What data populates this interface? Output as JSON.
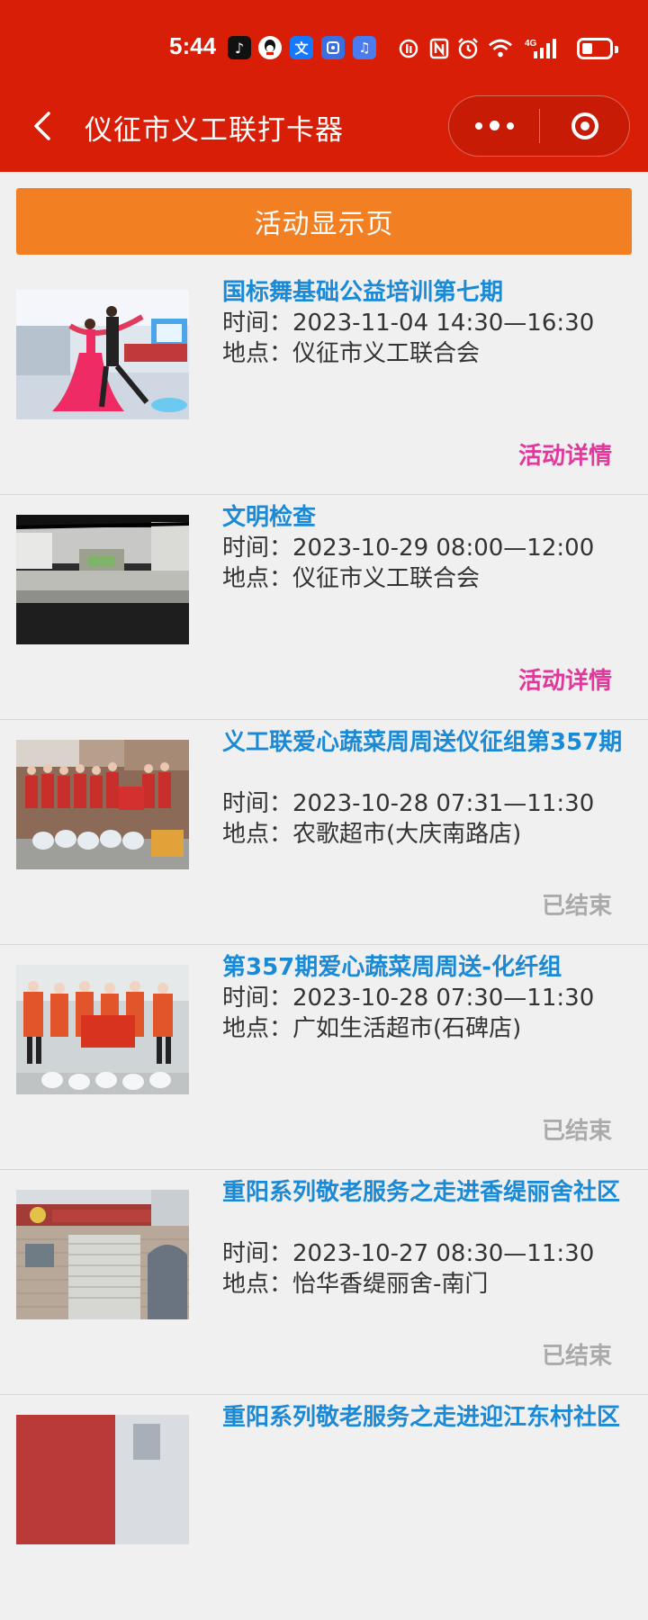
{
  "status_bar": {
    "time": "5:44",
    "network": "4G",
    "battery_level": 0.4,
    "icons": [
      "tiktok-icon",
      "qq-icon",
      "translate-icon",
      "app-store-icon",
      "music-icon",
      "nfc-icon",
      "alarm-icon",
      "wifi-icon",
      "signal-icon",
      "battery-icon"
    ]
  },
  "nav": {
    "title": "仪征市义工联打卡器"
  },
  "banner": {
    "label": "活动显示页"
  },
  "labels": {
    "time_prefix": "时间：",
    "place_prefix": "地点：",
    "detail": "活动详情",
    "ended": "已结束"
  },
  "activities": [
    {
      "title": "国标舞基础公益培训第七期",
      "time": "2023-11-04 14:30—16:30",
      "place": "仪征市义工联合会",
      "action": "活动详情",
      "status": "detail"
    },
    {
      "title": "文明检查",
      "time": "2023-10-29 08:00—12:00",
      "place": "仪征市义工联合会",
      "action": "活动详情",
      "status": "detail"
    },
    {
      "title": "义工联爱心蔬菜周周送仪征组第357期",
      "time": "2023-10-28 07:31—11:30",
      "place": "农歌超市(大庆南路店)",
      "action": "已结束",
      "status": "ended"
    },
    {
      "title": "第357期爱心蔬菜周周送-化纤组",
      "time": "2023-10-28 07:30—11:30",
      "place": "广如生活超市(石碑店)",
      "action": "已结束",
      "status": "ended"
    },
    {
      "title": "重阳系列敬老服务之走进香缇丽舍社区",
      "time": "2023-10-27 08:30—11:30",
      "place": "怡华香缇丽舍-南门",
      "action": "已结束",
      "status": "ended"
    },
    {
      "title": "重阳系列敬老服务之走进迎江东村社区",
      "time": "",
      "place": "",
      "action": "",
      "status": "partial"
    }
  ],
  "colors": {
    "header_bg": "#d81e06",
    "banner_bg": "#f37f23",
    "title": "#1b8ad6",
    "detail": "#e0389b",
    "ended": "#aaaaaa"
  }
}
